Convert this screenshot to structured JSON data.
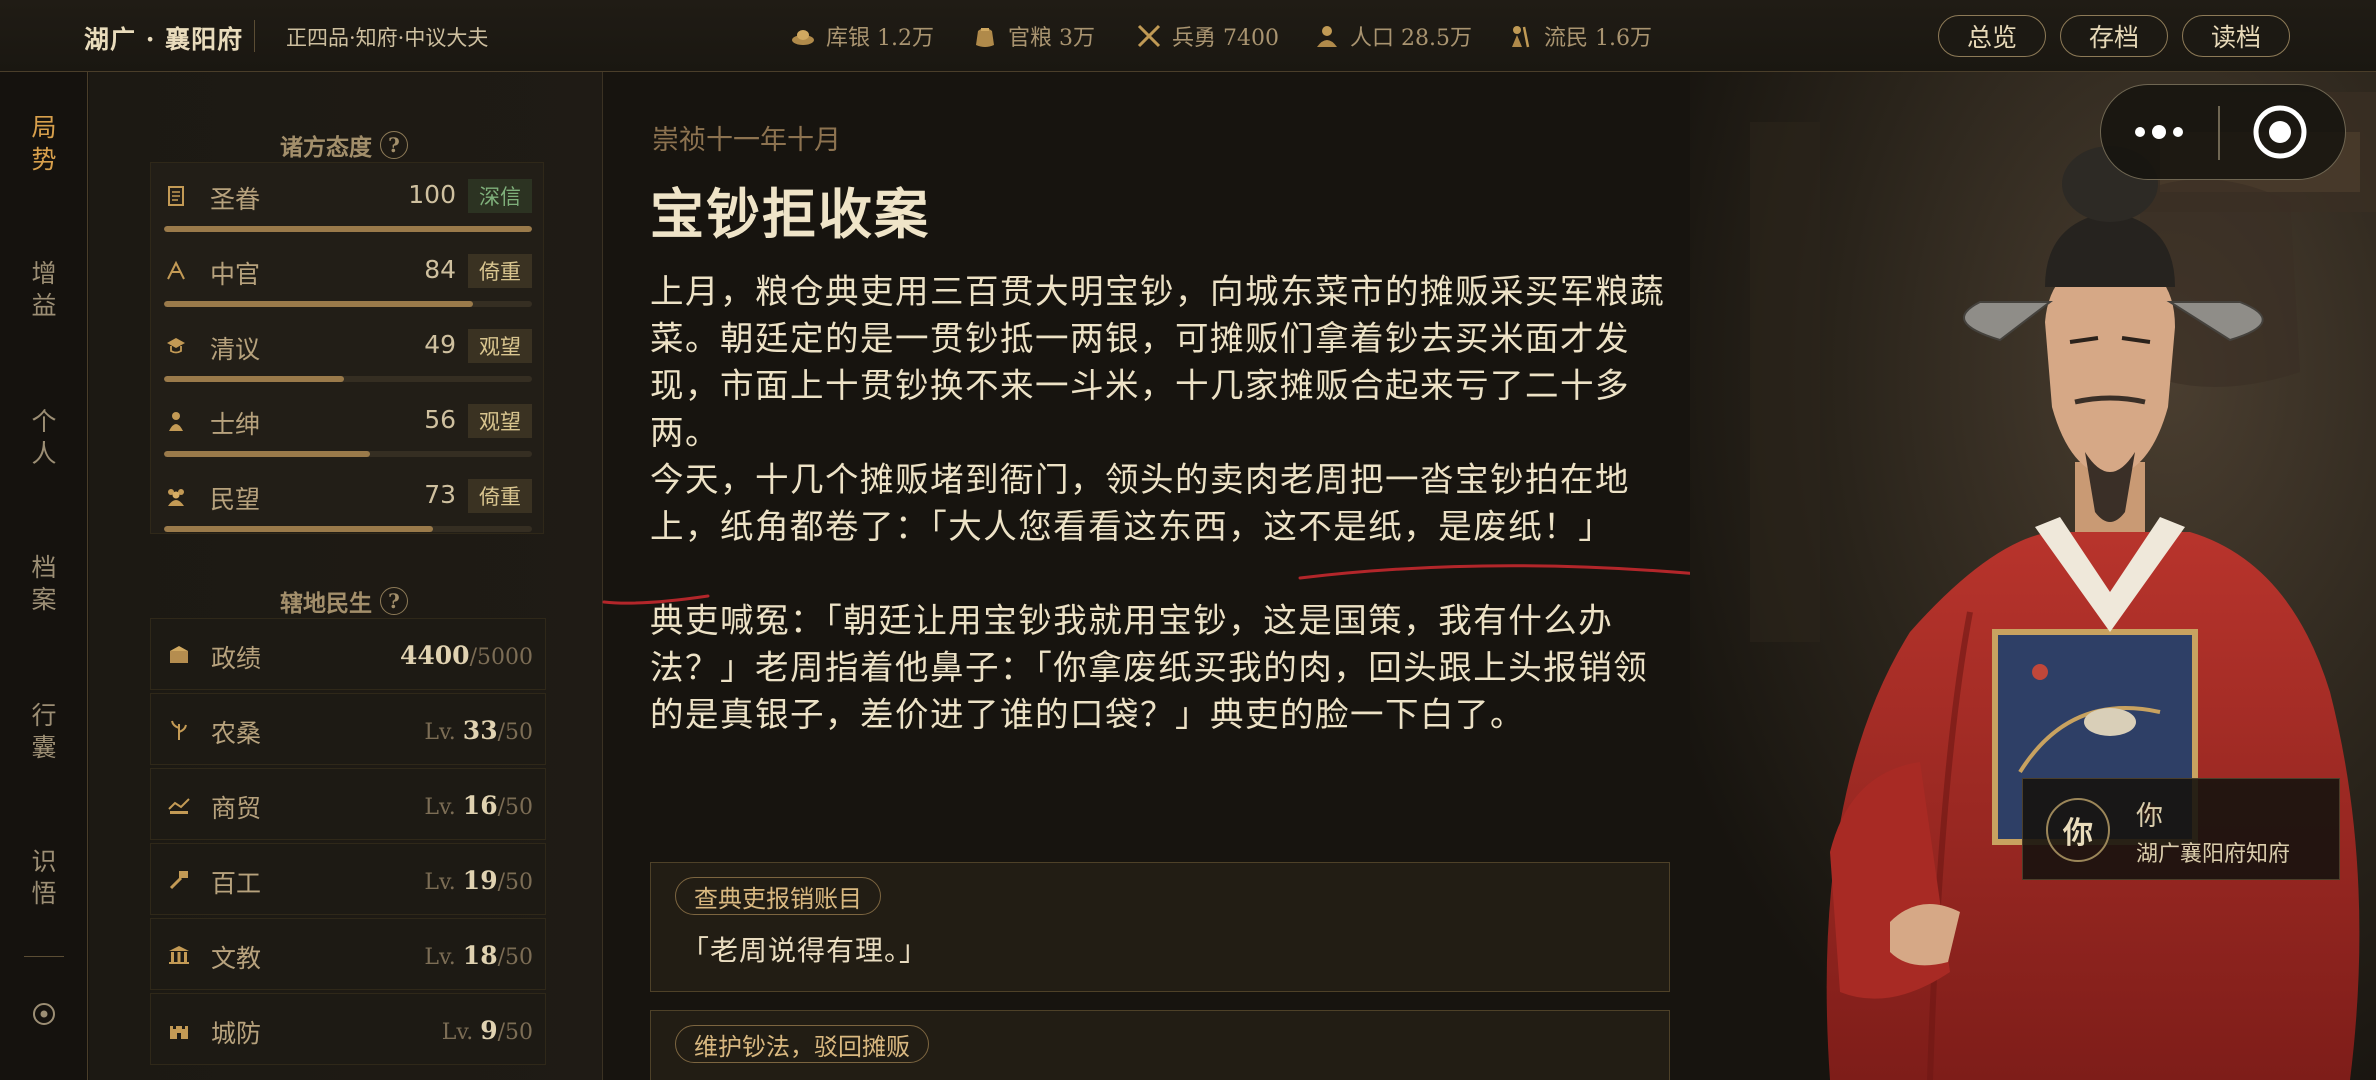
{
  "header": {
    "region": "湖广 · 襄阳府",
    "rank": "正四品·知府·中议大夫",
    "stats": [
      {
        "icon": "silver-ingot-icon",
        "label": "库银 1.2万"
      },
      {
        "icon": "grain-sack-icon",
        "label": "官粮 3万"
      },
      {
        "icon": "crossed-swords-icon",
        "label": "兵勇 7400"
      },
      {
        "icon": "population-icon",
        "label": "人口 28.5万"
      },
      {
        "icon": "refugee-icon",
        "label": "流民 1.6万"
      }
    ],
    "buttons": {
      "overview": "总览",
      "save": "存档",
      "load": "读档"
    }
  },
  "nav": {
    "items": [
      {
        "label": "局\n势",
        "active": true
      },
      {
        "label": "增\n益"
      },
      {
        "label": "个\n人"
      },
      {
        "label": "档\n案"
      },
      {
        "label": "行\n囊"
      },
      {
        "label": "识\n悟"
      }
    ],
    "settings_icon": "target-circle-icon"
  },
  "attitudes": {
    "title": "诸方态度",
    "help": "?",
    "items": [
      {
        "name": "圣眷",
        "value": "100",
        "badge": "深信",
        "level": 1.0,
        "icon": "scroll-icon"
      },
      {
        "name": "中官",
        "value": "84",
        "badge": "倚重",
        "level": 0.84,
        "icon": "eunuch-icon"
      },
      {
        "name": "清议",
        "value": "49",
        "badge": "观望",
        "level": 0.49,
        "icon": "scholar-icon"
      },
      {
        "name": "士绅",
        "value": "56",
        "badge": "观望",
        "level": 0.56,
        "icon": "gentry-icon"
      },
      {
        "name": "民望",
        "value": "73",
        "badge": "倚重",
        "level": 0.73,
        "icon": "people-icon"
      }
    ]
  },
  "metrics": {
    "title": "辖地民生",
    "help": "?",
    "items": [
      {
        "name": "政绩",
        "prefix": "",
        "value": "4400",
        "max": "/5000",
        "icon": "merit-icon"
      },
      {
        "name": "农桑",
        "prefix": "Lv.",
        "value": "33",
        "max": "/50",
        "icon": "farming-icon"
      },
      {
        "name": "商贸",
        "prefix": "Lv.",
        "value": "16",
        "max": "/50",
        "icon": "trade-icon"
      },
      {
        "name": "百工",
        "prefix": "Lv.",
        "value": "19",
        "max": "/50",
        "icon": "craft-icon"
      },
      {
        "name": "文教",
        "prefix": "Lv.",
        "value": "18",
        "max": "/50",
        "icon": "education-icon"
      },
      {
        "name": "城防",
        "prefix": "Lv.",
        "value": "9",
        "max": "/50",
        "icon": "fortress-icon"
      }
    ]
  },
  "event": {
    "date": "崇祯十一年十月",
    "title": "宝钞拒收案",
    "paragraphs": [
      "上月，粮仓典吏用三百贯大明宝钞，向城东菜市的摊贩采买军粮蔬菜。朝廷定的是一贯钞抵一两银，可摊贩们拿着钞去买米面才发现，市面上十贯钞换不来一斗米，十几家摊贩合起来亏了二十多两。",
      "今天，十几个摊贩堵到衙门，领头的卖肉老周把一沓宝钞拍在地上，纸角都卷了：「大人您看看这东西，这不是纸，是废纸！」",
      "典吏喊冤：「朝廷让用宝钞我就用宝钞，这是国策，我有什么办法？」老周指着他鼻子：「你拿废纸买我的肉，回头跟上头报销领的是真银子，差价进了谁的口袋？」典吏的脸一下白了。"
    ],
    "options": [
      {
        "tag": "查典吏报销账目",
        "text": "「老周说得有理。」"
      },
      {
        "tag": "维护钞法，驳回摊贩",
        "text": ""
      }
    ]
  },
  "player": {
    "avatar": "你",
    "name": "你",
    "title": "湖广襄阳府知府"
  },
  "capsule": {
    "menu_icon": "more-dots-icon",
    "close_icon": "record-circle-icon"
  }
}
